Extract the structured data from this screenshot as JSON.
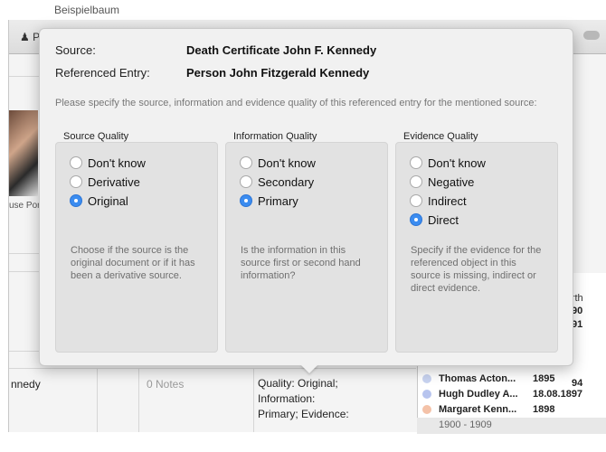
{
  "background": {
    "top_strip_text": "Beispielbaum",
    "toolbar_person_label": "P",
    "spouse_label": "use Por",
    "row_name": "nnedy",
    "notes_label": "0 Notes",
    "quality_lines": [
      "Quality: Original;",
      "Information:",
      "Primary; Evidence:"
    ],
    "birth_header": "Birth",
    "birth_values": [
      "90",
      "91",
      "94"
    ],
    "people": [
      {
        "name": "Thomas Acton...",
        "date": "1895",
        "color": "#c8d3f0"
      },
      {
        "name": "Hugh Dudley A...",
        "date": "18.08.1897",
        "color": "#b7c4ee"
      },
      {
        "name": "Margaret Kenn...",
        "date": "1898",
        "color": "#f4c2a8"
      }
    ],
    "people_footer": "1900 - 1909"
  },
  "popover": {
    "source_label": "Source:",
    "source_value": "Death Certificate John F. Kennedy",
    "entry_label": "Referenced Entry:",
    "entry_value": "Person John Fitzgerald Kennedy",
    "instructions": "Please specify the source, information and evidence quality of this referenced entry for the mentioned source:",
    "groups": [
      {
        "title": "Source Quality",
        "options": [
          "Don't know",
          "Derivative",
          "Original"
        ],
        "selected": "Original",
        "help": "Choose if the source is the original document or if it has been a derivative source."
      },
      {
        "title": "Information Quality",
        "options": [
          "Don't know",
          "Secondary",
          "Primary"
        ],
        "selected": "Primary",
        "help": "Is the information in this source first or second hand information?"
      },
      {
        "title": "Evidence Quality",
        "options": [
          "Don't know",
          "Negative",
          "Indirect",
          "Direct"
        ],
        "selected": "Direct",
        "help": "Specify if the evidence for the referenced object in this source is missing, indirect or direct evidence."
      }
    ]
  },
  "colors": {
    "radio_selected": "#3b8cf0",
    "popover_bg": "#f1f1f1",
    "group_bg": "#e2e2e2"
  }
}
